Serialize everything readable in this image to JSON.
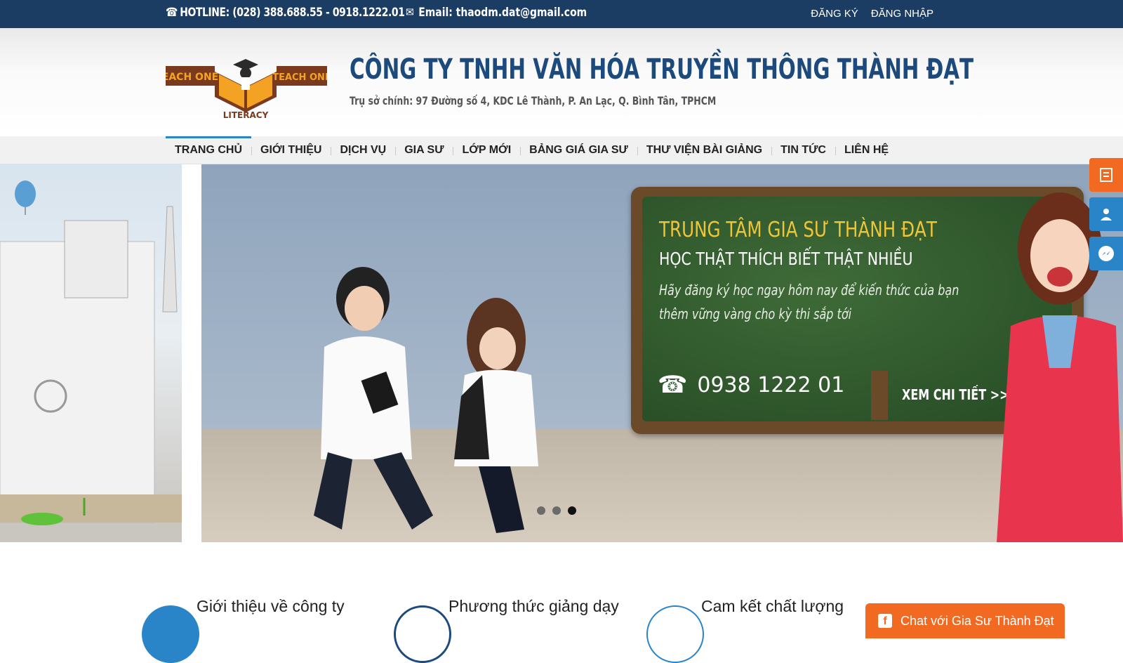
{
  "topbar": {
    "hotline": "HOTLINE: (028) 388.688.55 - 0918.1222.01",
    "email": "Email: thaodm.dat@gmail.com",
    "register": "ĐĂNG KÝ",
    "login": "ĐĂNG NHẬP"
  },
  "header": {
    "logo_left": "EACH ONE",
    "logo_right": "TEACH ONE",
    "logo_bottom": "LITERACY",
    "company_name": "CÔNG TY TNHH VĂN HÓA TRUYỀN THÔNG THÀNH ĐẠT",
    "address": "Trụ sở chính: 97 Đường số 4, KDC Lê Thành, P. An Lạc, Q. Bình Tân, TPHCM"
  },
  "nav": {
    "items": [
      {
        "label": "TRANG CHỦ"
      },
      {
        "label": "GIỚI THIỆU"
      },
      {
        "label": "DỊCH VỤ"
      },
      {
        "label": "GIA SƯ"
      },
      {
        "label": "LỚP MỚI"
      },
      {
        "label": "BẢNG GIÁ GIA SƯ"
      },
      {
        "label": "THƯ VIỆN BÀI GIẢNG"
      },
      {
        "label": "TIN TỨC"
      },
      {
        "label": "LIÊN HỆ"
      }
    ],
    "active_index": 0
  },
  "slider": {
    "title": "TRUNG TÂM GIA SƯ THÀNH ĐẠT",
    "subtitle": "HỌC THẬT THÍCH BIẾT THẬT NHIỀU",
    "desc_line1": "Hãy đăng ký học ngay hôm nay để kiến thức của bạn",
    "desc_line2": "thêm vững vàng cho kỳ thi sắp tới",
    "phone": "0938 1222 01",
    "more": "XEM CHI TIẾT >>",
    "slide_count": 3,
    "active_slide": 3
  },
  "side_tools": [
    "register-form-icon",
    "tutor-icon",
    "messenger-icon"
  ],
  "features": {
    "about": "Giới thiệu về công ty",
    "method": "Phương thức giảng dạy",
    "commitment": "Cam kết chất lượng"
  },
  "chat": {
    "label": "Chat với Gia Sư Thành Đạt"
  },
  "colors": {
    "topbar": "#1c3d63",
    "brand_blue": "#1d4a7d",
    "accent_orange": "#f26a21",
    "accent_blue": "#2a84c8",
    "board_yellow": "#f0c437"
  }
}
